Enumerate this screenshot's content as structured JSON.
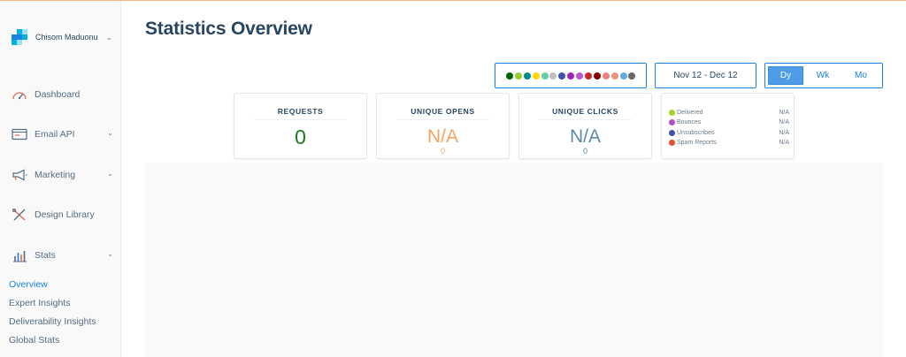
{
  "account": {
    "name": "Chisom Maduonu",
    "logo_colors": [
      "#1a82e2",
      "#00b3e3",
      "#99e1f4",
      "#294661"
    ]
  },
  "sidebar": {
    "items": [
      {
        "label": "Dashboard",
        "icon": "gauge-icon"
      },
      {
        "label": "Email API",
        "icon": "email-api-icon"
      },
      {
        "label": "Marketing",
        "icon": "megaphone-icon"
      },
      {
        "label": "Design Library",
        "icon": "design-tools-icon"
      },
      {
        "label": "Stats",
        "icon": "bar-chart-icon"
      }
    ],
    "sub_items": [
      {
        "label": "Overview",
        "active": true
      },
      {
        "label": "Expert Insights"
      },
      {
        "label": "Deliverability Insights"
      },
      {
        "label": "Global Stats"
      }
    ]
  },
  "page": {
    "title": "Statistics Overview"
  },
  "filters": {
    "color_dots": [
      "#006400",
      "#9acd32",
      "#008b8b",
      "#ffd700",
      "#66cdaa",
      "#c0c0c0",
      "#3f51b5",
      "#9c27b0",
      "#ba55d3",
      "#c62828",
      "#8b0000",
      "#f08080",
      "#e9967a",
      "#5dade2",
      "#666666"
    ],
    "date_range": "Nov 12 - Dec 12",
    "period_options": [
      "Dy",
      "Wk",
      "Mo"
    ],
    "period_selected": "Dy"
  },
  "cards": {
    "requests": {
      "title": "REQUESTS",
      "value": "0",
      "color": "#1b7a1b"
    },
    "unique_opens": {
      "title": "UNIQUE OPENS",
      "value": "N/A",
      "sub": "0",
      "color": "#f4a45f"
    },
    "unique_clicks": {
      "title": "UNIQUE CLICKS",
      "value": "N/A",
      "sub": "0",
      "color": "#5c8aa8"
    }
  },
  "legend": [
    {
      "label": "Delivered",
      "value": "N/A",
      "color": "#a6d22b"
    },
    {
      "label": "Bounces",
      "value": "N/A",
      "color": "#b04fc9"
    },
    {
      "label": "Unsubscribes",
      "value": "N/A",
      "color": "#3f51b5"
    },
    {
      "label": "Spam Reports",
      "value": "N/A",
      "color": "#e0522d"
    }
  ]
}
